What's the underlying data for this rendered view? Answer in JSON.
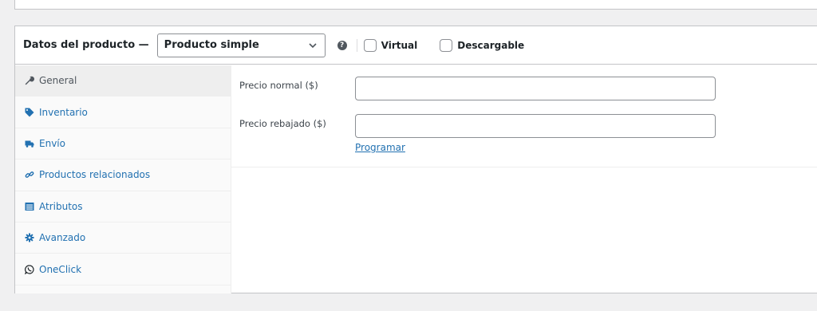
{
  "header": {
    "title": "Datos del producto —",
    "product_type": "Producto simple",
    "help": "?",
    "virtual_label": "Virtual",
    "downloadable_label": "Descargable"
  },
  "tabs": [
    {
      "label": "General",
      "icon": "wrench-icon",
      "active": true
    },
    {
      "label": "Inventario",
      "icon": "tag-icon"
    },
    {
      "label": "Envío",
      "icon": "truck-icon"
    },
    {
      "label": "Productos relacionados",
      "icon": "link-icon"
    },
    {
      "label": "Atributos",
      "icon": "list-table-icon"
    },
    {
      "label": "Avanzado",
      "icon": "gear-icon"
    },
    {
      "label": "OneClick",
      "icon": "whatsapp-icon"
    }
  ],
  "general": {
    "regular_price_label": "Precio normal ($)",
    "regular_price_value": "",
    "sale_price_label": "Precio rebajado ($)",
    "sale_price_value": "",
    "schedule_link": "Programar"
  },
  "colors": {
    "link": "#2271b1",
    "border": "#c3c4c7",
    "background": "#f0f0f1"
  }
}
